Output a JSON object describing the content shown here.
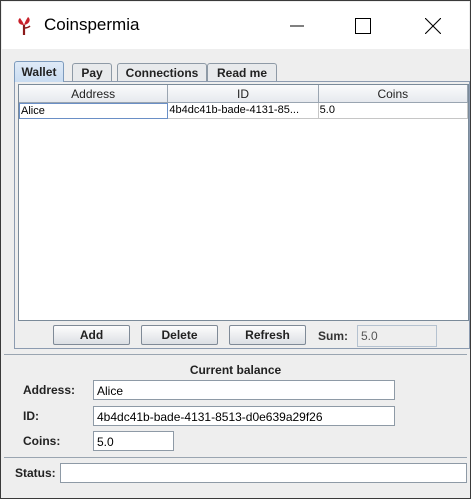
{
  "window": {
    "title": "Coinspermia"
  },
  "tabs": [
    {
      "label": "Wallet",
      "active": true
    },
    {
      "label": "Pay",
      "active": false
    },
    {
      "label": "Connections",
      "active": false
    },
    {
      "label": "Read me",
      "active": false
    }
  ],
  "table": {
    "columns": [
      "Address",
      "ID",
      "Coins"
    ],
    "rows": [
      {
        "address": "Alice",
        "id": "4b4dc41b-bade-4131-85...",
        "coins": "5.0"
      }
    ]
  },
  "buttons": {
    "add": "Add",
    "delete": "Delete",
    "refresh": "Refresh"
  },
  "sum": {
    "label": "Sum:",
    "value": "5.0"
  },
  "balance": {
    "title": "Current balance",
    "address_label": "Address:",
    "address_value": "Alice",
    "id_label": "ID:",
    "id_value": "4b4dc41b-bade-4131-8513-d0e639a29f26",
    "coins_label": "Coins:",
    "coins_value": "5.0"
  },
  "status": {
    "label": "Status:",
    "value": ""
  },
  "colors": {
    "active_tab": "#c9dcf1",
    "icon_red": "#c8202a"
  },
  "icons": {
    "app": "seedling-icon",
    "minimize": "minimize-icon",
    "maximize": "maximize-icon",
    "close": "close-icon"
  }
}
